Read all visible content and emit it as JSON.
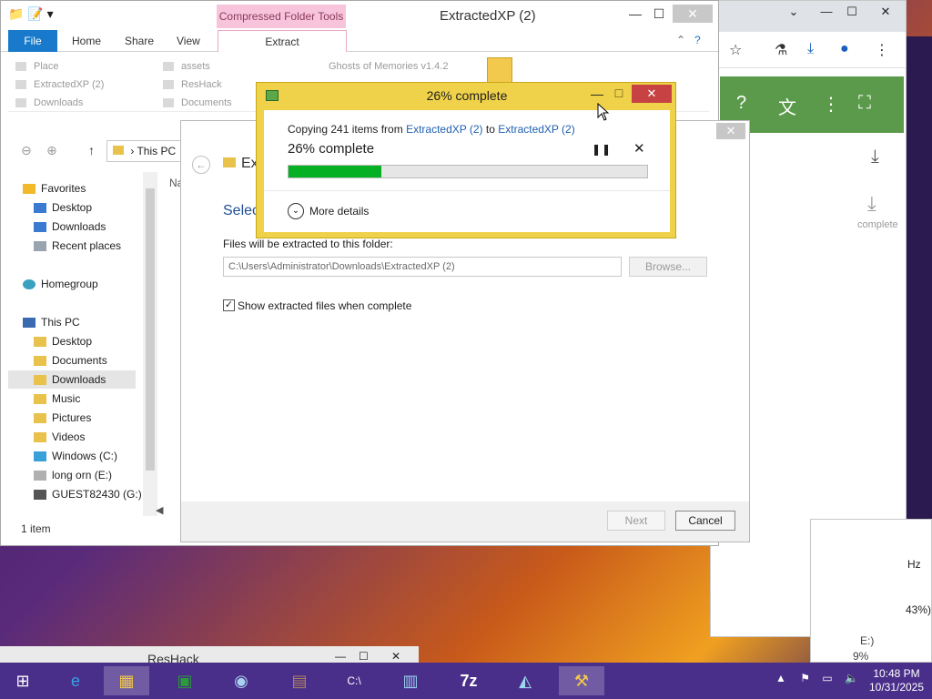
{
  "explorer": {
    "title": "ExtractedXP (2)",
    "context_tab": "Compressed Folder Tools",
    "ribbon_tabs": [
      "File",
      "Home",
      "Share",
      "View",
      "Extract"
    ],
    "recent": [
      {
        "label": "Place"
      },
      {
        "label": "ExtractedXP (2)"
      },
      {
        "label": "Downloads"
      },
      {
        "label": "assets"
      },
      {
        "label": "ResHack"
      },
      {
        "label": "Documents"
      },
      {
        "label": "Ghosts of Memories v1.4.2"
      }
    ],
    "address": "This PC",
    "column_header": "Na",
    "nav_items": [
      {
        "label": "Favorites",
        "icon": "star-icon",
        "indent": 0
      },
      {
        "label": "Desktop",
        "icon": "desktop-icon",
        "indent": 1
      },
      {
        "label": "Downloads",
        "icon": "downloads-icon",
        "indent": 1
      },
      {
        "label": "Recent places",
        "icon": "recent-icon",
        "indent": 1
      },
      {
        "label": "Homegroup",
        "icon": "homegroup-icon",
        "indent": 0
      },
      {
        "label": "This PC",
        "icon": "computer-icon",
        "indent": 0
      },
      {
        "label": "Desktop",
        "icon": "desktop-icon",
        "indent": 1
      },
      {
        "label": "Documents",
        "icon": "folder-icon",
        "indent": 1
      },
      {
        "label": "Downloads",
        "icon": "downloads-icon",
        "indent": 1,
        "selected": true
      },
      {
        "label": "Music",
        "icon": "folder-icon",
        "indent": 1
      },
      {
        "label": "Pictures",
        "icon": "folder-icon",
        "indent": 1
      },
      {
        "label": "Videos",
        "icon": "folder-icon",
        "indent": 1
      },
      {
        "label": "Windows (C:)",
        "icon": "windows-drive-icon",
        "indent": 1
      },
      {
        "label": "long orn (E:)",
        "icon": "drive-icon",
        "indent": 1
      },
      {
        "label": "GUEST82430 (G:)",
        "icon": "usb-drive-icon",
        "indent": 1
      }
    ],
    "status": "1 item"
  },
  "wizard": {
    "header": "Ext",
    "select_label": "Selec",
    "dest_label": "Files will be extracted to this folder:",
    "dest_path": "C:\\Users\\Administrator\\Downloads\\ExtractedXP (2)",
    "browse": "Browse...",
    "checkbox_label": "Show extracted files when complete",
    "checkbox_checked": true,
    "next": "Next",
    "cancel": "Cancel"
  },
  "progress": {
    "title": "26% complete",
    "copying_prefix": "Copying 241 items from ",
    "from": "ExtractedXP (2)",
    "to_word": " to ",
    "to": "ExtractedXP (2)",
    "percent_text": "26% complete",
    "percent": 26,
    "more_details": "More details"
  },
  "chrome": {
    "complete_label": "complete"
  },
  "side_panel": {
    "hz": "Hz",
    "pct43": "43%)",
    "drive_partial": "E:)",
    "pct9": "9%"
  },
  "reshack": {
    "label": "ResHack"
  },
  "taskbar": {
    "time": "10:48 PM",
    "date": "10/31/2025"
  },
  "colors": {
    "progress_fill": "#06b025",
    "dialog_frame": "#f0d24a",
    "file_tab": "#1979ca",
    "context_tab": "#f7c4dc",
    "close_red": "#c74343"
  }
}
